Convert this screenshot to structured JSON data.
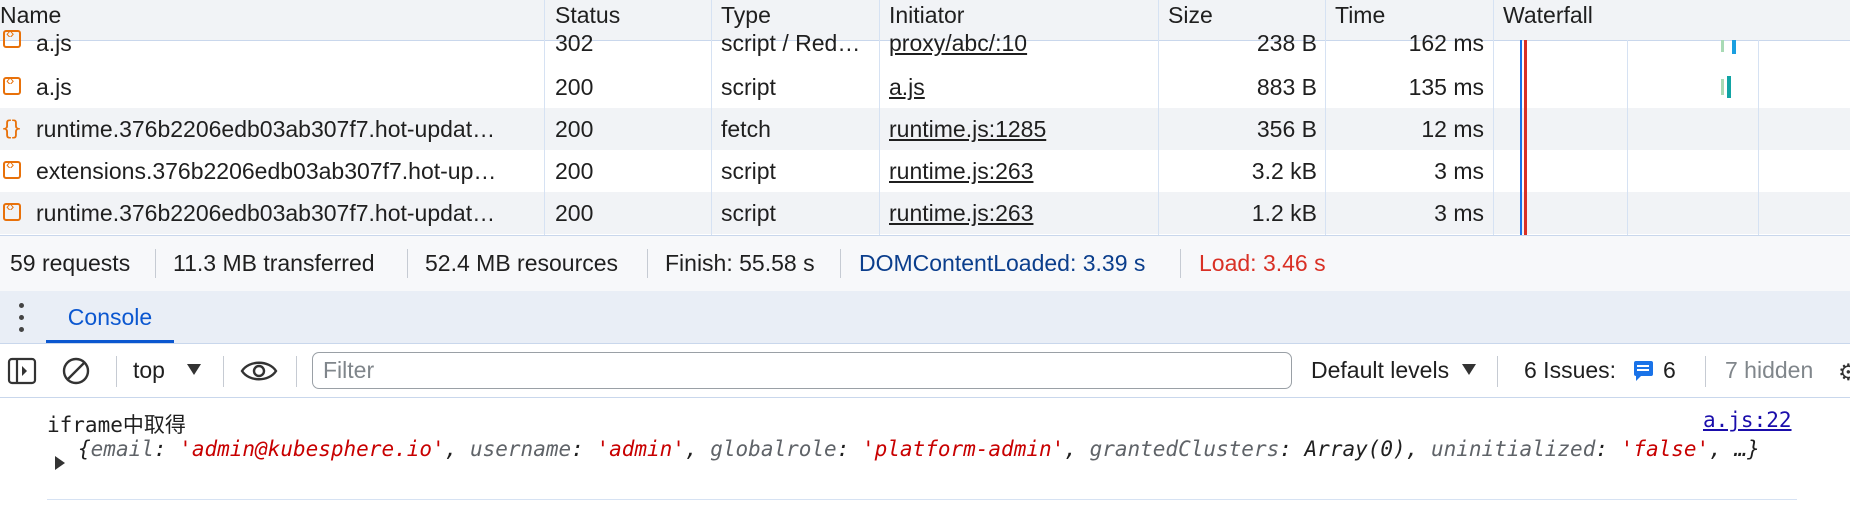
{
  "network": {
    "columns": [
      "Name",
      "Status",
      "Type",
      "Initiator",
      "Size",
      "Time",
      "Waterfall"
    ],
    "rows": [
      {
        "icon": "script-icon",
        "name": "a.js",
        "status": "302",
        "type": "script / Red…",
        "initiator": "proxy/abc/:10",
        "size": "238 B",
        "time": "162 ms"
      },
      {
        "icon": "script-icon",
        "name": "a.js",
        "status": "200",
        "type": "script",
        "initiator": "a.js",
        "size": "883 B",
        "time": "135 ms"
      },
      {
        "icon": "fetch-icon",
        "name": "runtime.376b2206edb03ab307f7.hot-updat…",
        "status": "200",
        "type": "fetch",
        "initiator": "runtime.js:1285",
        "size": "356 B",
        "time": "12 ms"
      },
      {
        "icon": "script-icon",
        "name": "extensions.376b2206edb03ab307f7.hot-up…",
        "status": "200",
        "type": "script",
        "initiator": "runtime.js:263",
        "size": "3.2 kB",
        "time": "3 ms"
      },
      {
        "icon": "script-icon",
        "name": "runtime.376b2206edb03ab307f7.hot-updat…",
        "status": "200",
        "type": "script",
        "initiator": "runtime.js:263",
        "size": "1.2 kB",
        "time": "3 ms"
      }
    ]
  },
  "summary": {
    "requests": "59 requests",
    "transferred": "11.3 MB transferred",
    "resources": "52.4 MB resources",
    "finish": "Finish: 55.58 s",
    "dom_content_loaded": "DOMContentLoaded: 3.39 s",
    "load": "Load: 3.46 s"
  },
  "drawer": {
    "tab_console": "Console"
  },
  "console_toolbar": {
    "context": "top",
    "filter_placeholder": "Filter",
    "filter_value": "",
    "levels": "Default levels",
    "issues_label": "6 Issues:",
    "issues_count": "6",
    "hidden": "7 hidden"
  },
  "console": {
    "message_label": "iframe中取得",
    "message_source": "a.js:22",
    "object": {
      "open": "{",
      "k1": "email",
      "v1": "'admin@kubesphere.io'",
      "k2": "username",
      "v2": "'admin'",
      "k3": "globalrole",
      "v3": "'platform-admin'",
      "k4": "grantedClusters",
      "v4": "Array(0)",
      "k5": "uninitialized",
      "v5": "'false'",
      "close": ", …}"
    }
  },
  "colors": {
    "accent": "#0b57d0",
    "dom_content_loaded": "#0b3e8c",
    "load": "#d93025",
    "string_value": "#c80000",
    "resource_icon": "#e8710a"
  }
}
